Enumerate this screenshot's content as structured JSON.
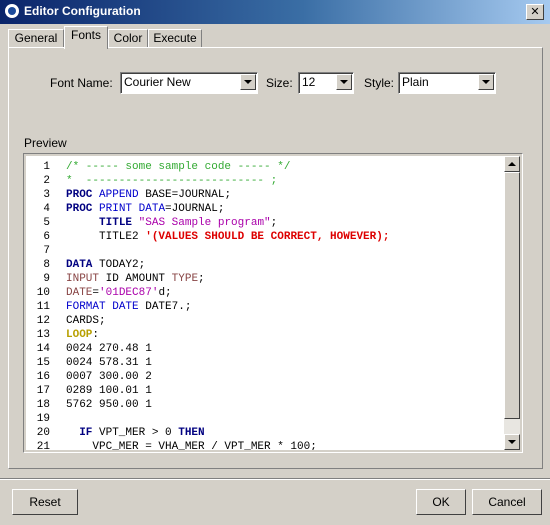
{
  "window": {
    "title": "Editor Configuration",
    "close_label": "✕"
  },
  "tabs": [
    {
      "label": "General",
      "active": false
    },
    {
      "label": "Fonts",
      "active": true
    },
    {
      "label": "Color",
      "active": false
    },
    {
      "label": "Execute",
      "active": false
    }
  ],
  "fonts": {
    "name_label": "Font Name:",
    "name_value": "Courier New",
    "size_label": "Size:",
    "size_value": "12",
    "style_label": "Style:",
    "style_value": "Plain"
  },
  "preview": {
    "label": "Preview",
    "lines": [
      {
        "n": "1",
        "segments": [
          {
            "t": "/* ----- some sample code ----- */",
            "c": "#33aa33"
          }
        ]
      },
      {
        "n": "2",
        "segments": [
          {
            "t": "*  --------------------------- ;",
            "c": "#33aa33"
          }
        ]
      },
      {
        "n": "3",
        "segments": [
          {
            "t": "PROC",
            "c": "#000080",
            "b": true
          },
          {
            "t": " ",
            "c": "#000"
          },
          {
            "t": "APPEND",
            "c": "#0000cc"
          },
          {
            "t": " BASE=JOURNAL;",
            "c": "#000"
          }
        ]
      },
      {
        "n": "4",
        "segments": [
          {
            "t": "PROC",
            "c": "#000080",
            "b": true
          },
          {
            "t": " ",
            "c": "#000"
          },
          {
            "t": "PRINT",
            "c": "#0000cc"
          },
          {
            "t": " ",
            "c": "#000"
          },
          {
            "t": "DATA",
            "c": "#0000cc"
          },
          {
            "t": "=JOURNAL;",
            "c": "#000"
          }
        ]
      },
      {
        "n": "5",
        "segments": [
          {
            "t": "     ",
            "c": "#000"
          },
          {
            "t": "TITLE",
            "c": "#000080",
            "b": true
          },
          {
            "t": " ",
            "c": "#000"
          },
          {
            "t": "\"SAS Sample program\"",
            "c": "#aa00aa"
          },
          {
            "t": ";",
            "c": "#000"
          }
        ]
      },
      {
        "n": "6",
        "segments": [
          {
            "t": "     TITLE2 ",
            "c": "#000"
          },
          {
            "t": "'(VALUES SHOULD BE CORRECT, HOWEVER);",
            "c": "#dd0000",
            "b": true
          }
        ]
      },
      {
        "n": "7",
        "segments": []
      },
      {
        "n": "8",
        "segments": [
          {
            "t": "DATA",
            "c": "#000080",
            "b": true
          },
          {
            "t": " TODAY2;",
            "c": "#000"
          }
        ]
      },
      {
        "n": "9",
        "segments": [
          {
            "t": "INPUT",
            "c": "#884444"
          },
          {
            "t": " ID AMOUNT ",
            "c": "#000"
          },
          {
            "t": "TYPE",
            "c": "#884444"
          },
          {
            "t": ";",
            "c": "#000"
          }
        ]
      },
      {
        "n": "10",
        "segments": [
          {
            "t": "DATE",
            "c": "#884444"
          },
          {
            "t": "=",
            "c": "#000"
          },
          {
            "t": "'01DEC87'",
            "c": "#aa00aa"
          },
          {
            "t": "d;",
            "c": "#000"
          }
        ]
      },
      {
        "n": "11",
        "segments": [
          {
            "t": "FORMAT",
            "c": "#0000cc"
          },
          {
            "t": " ",
            "c": "#000"
          },
          {
            "t": "DATE",
            "c": "#0000cc"
          },
          {
            "t": " DATE7.;",
            "c": "#000"
          }
        ]
      },
      {
        "n": "12",
        "segments": [
          {
            "t": "CARDS;",
            "c": "#000"
          }
        ]
      },
      {
        "n": "13",
        "segments": [
          {
            "t": "LOOP",
            "c": "#b8a000",
            "b": true
          },
          {
            "t": ":",
            "c": "#000"
          }
        ]
      },
      {
        "n": "14",
        "segments": [
          {
            "t": "0024 270.48 1",
            "c": "#000"
          }
        ]
      },
      {
        "n": "15",
        "segments": [
          {
            "t": "0024 578.31 1",
            "c": "#000"
          }
        ]
      },
      {
        "n": "16",
        "segments": [
          {
            "t": "0007 300.00 2",
            "c": "#000"
          }
        ]
      },
      {
        "n": "17",
        "segments": [
          {
            "t": "0289 100.01 1",
            "c": "#000"
          }
        ]
      },
      {
        "n": "18",
        "segments": [
          {
            "t": "5762 950.00 1",
            "c": "#000"
          }
        ]
      },
      {
        "n": "19",
        "segments": []
      },
      {
        "n": "20",
        "segments": [
          {
            "t": "  ",
            "c": "#000"
          },
          {
            "t": "IF",
            "c": "#000080",
            "b": true
          },
          {
            "t": " VPT_MER > 0 ",
            "c": "#000"
          },
          {
            "t": "THEN",
            "c": "#000080",
            "b": true
          }
        ]
      },
      {
        "n": "21",
        "segments": [
          {
            "t": "    VPC_MER = VHA_MER / VPT_MER * 100;",
            "c": "#000"
          }
        ]
      }
    ]
  },
  "buttons": {
    "reset": "Reset",
    "ok": "OK",
    "cancel": "Cancel"
  }
}
